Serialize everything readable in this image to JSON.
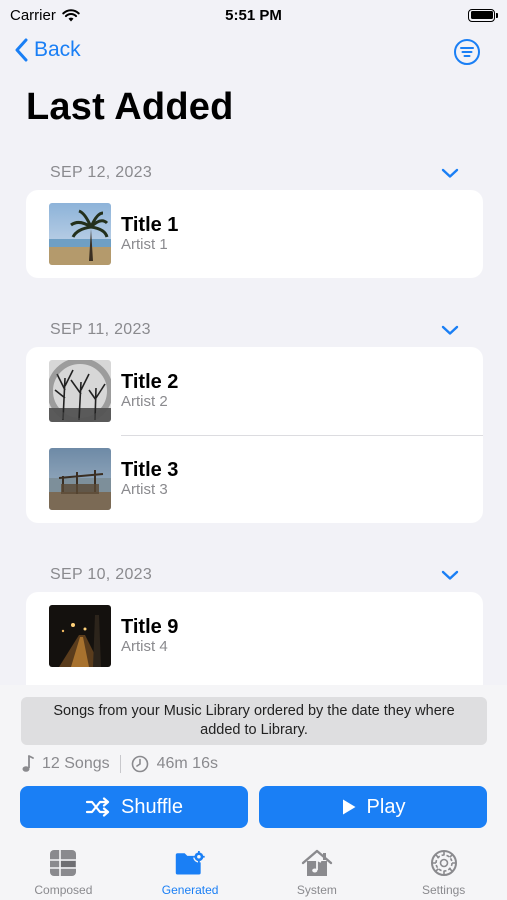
{
  "status_bar": {
    "carrier": "Carrier",
    "time": "5:51 PM"
  },
  "nav": {
    "back_label": "Back"
  },
  "page": {
    "title": "Last Added"
  },
  "sections": [
    {
      "date": "SEP 12, 2023",
      "items": [
        {
          "title": "Title 1",
          "artist": "Artist 1"
        }
      ]
    },
    {
      "date": "SEP 11, 2023",
      "items": [
        {
          "title": "Title 2",
          "artist": "Artist 2"
        },
        {
          "title": "Title 3",
          "artist": "Artist 3"
        }
      ]
    },
    {
      "date": "SEP 10, 2023",
      "items": [
        {
          "title": "Title 9",
          "artist": "Artist 4"
        }
      ]
    }
  ],
  "info": {
    "description": "Songs from your Music Library ordered by the date they where added to Library.",
    "songs_count": "12 Songs",
    "duration": "46m 16s"
  },
  "actions": {
    "shuffle_label": "Shuffle",
    "play_label": "Play"
  },
  "tabs": [
    {
      "label": "Composed",
      "icon": "composed-grid-icon"
    },
    {
      "label": "Generated",
      "icon": "gear-folder-icon"
    },
    {
      "label": "System",
      "icon": "house-music-icon"
    },
    {
      "label": "Settings",
      "icon": "gear-icon"
    }
  ],
  "colors": {
    "accent": "#1a7ff5",
    "background": "#f2f2f7",
    "secondary_text": "#8a8a8e"
  }
}
